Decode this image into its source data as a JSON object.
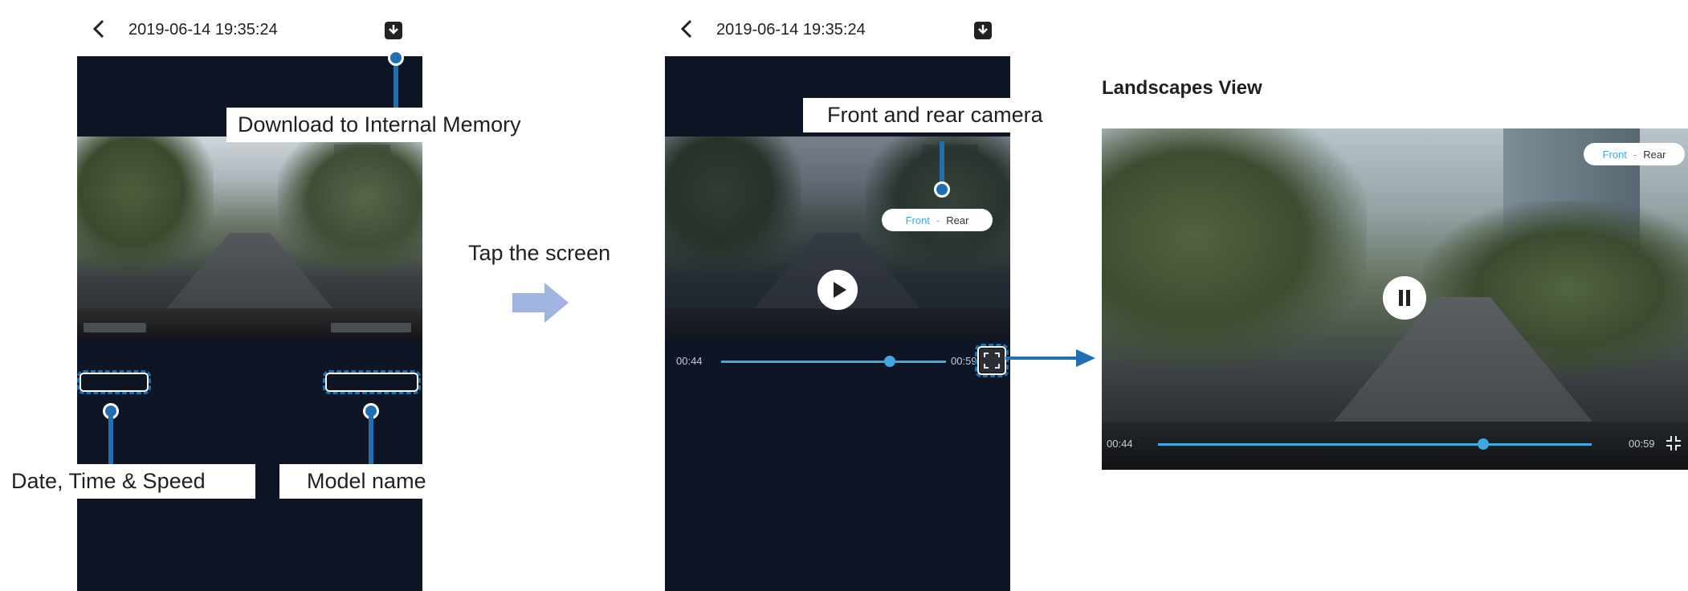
{
  "screens": {
    "left": {
      "header": {
        "back_icon": "chevron-left-icon",
        "timestamp": "2019-06-14 19:35:24",
        "download_icon": "download-icon"
      },
      "callouts": {
        "download": "Download to Internal Memory",
        "date_time_speed": "Date, Time & Speed",
        "model_name": "Model name"
      }
    },
    "middle": {
      "header": {
        "back_icon": "chevron-left-icon",
        "timestamp": "2019-06-14 19:35:24",
        "download_icon": "download-icon"
      },
      "callouts": {
        "front_rear": "Front and rear camera"
      },
      "player": {
        "current_time": "00:44",
        "total_time": "00:59",
        "progress": 0.75,
        "toggle_front": "Front",
        "toggle_sep": "-",
        "toggle_rear": "Rear",
        "play_icon": "play-icon",
        "fullscreen_icon": "fullscreen-icon"
      }
    },
    "landscape": {
      "title": "Landscapes View",
      "player": {
        "current_time": "00:44",
        "total_time": "00:59",
        "progress": 0.75,
        "toggle_front": "Front",
        "toggle_sep": "-",
        "toggle_rear": "Rear",
        "pause_icon": "pause-icon",
        "fullscreen_icon": "fullscreen-icon"
      }
    }
  },
  "transition": {
    "label": "Tap the screen",
    "arrow_icon": "arrow-right-icon"
  },
  "colors": {
    "accent": "#1f6fb2",
    "progress": "#3fa8e0",
    "screen_bg": "#0e1626",
    "arrow": "#9fb4de"
  }
}
